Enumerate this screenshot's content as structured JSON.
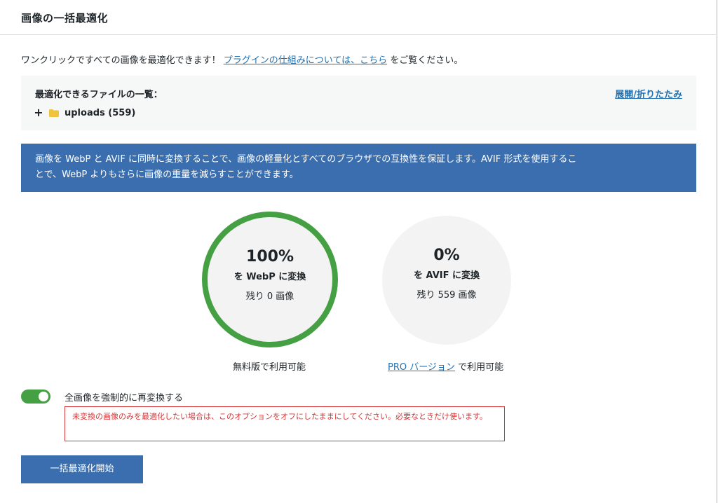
{
  "header": {
    "title": "画像の一括最適化"
  },
  "intro": {
    "text_before": "ワンクリックですべての画像を最適化できます！",
    "link_text": "プラグインの仕組みについては、こちら",
    "text_after": "をご覧ください。"
  },
  "files": {
    "title": "最適化できるファイルの一覧：",
    "toggle_label": "展開/折りたたみ",
    "expand_symbol": "+",
    "folder_label": "uploads (559)",
    "colors": {
      "folder": "#f0c33c"
    }
  },
  "banner": {
    "text": "画像を WebP と AVIF に同時に変換することで、画像の軽量化とすべてのブラウザでの互換性を保証します。AVIF 形式を使用することで、WebP よりもさらに画像の重量を減らすことができます。",
    "background": "#3a6eae"
  },
  "webp": {
    "percent": "100%",
    "label": "を WebP に変換",
    "remaining": "残り 0 画像",
    "availability": "無料版で利用可能",
    "progress": 1.0,
    "color": "#44a043"
  },
  "avif": {
    "percent": "0%",
    "label": "を AVIF に変換",
    "remaining": "残り 559 画像",
    "availability_link": "PRO バージョン",
    "availability_suffix": "で利用可能",
    "progress": 0.0
  },
  "force": {
    "label": "全画像を強制的に再変換する",
    "enabled": true,
    "warning": "未変換の画像のみを最適化したい場合は、このオプションをオフにしたままにしてください。必要なときだけ使います。",
    "warning_color": "#d63638"
  },
  "actions": {
    "start_label": "一括最適化開始"
  }
}
